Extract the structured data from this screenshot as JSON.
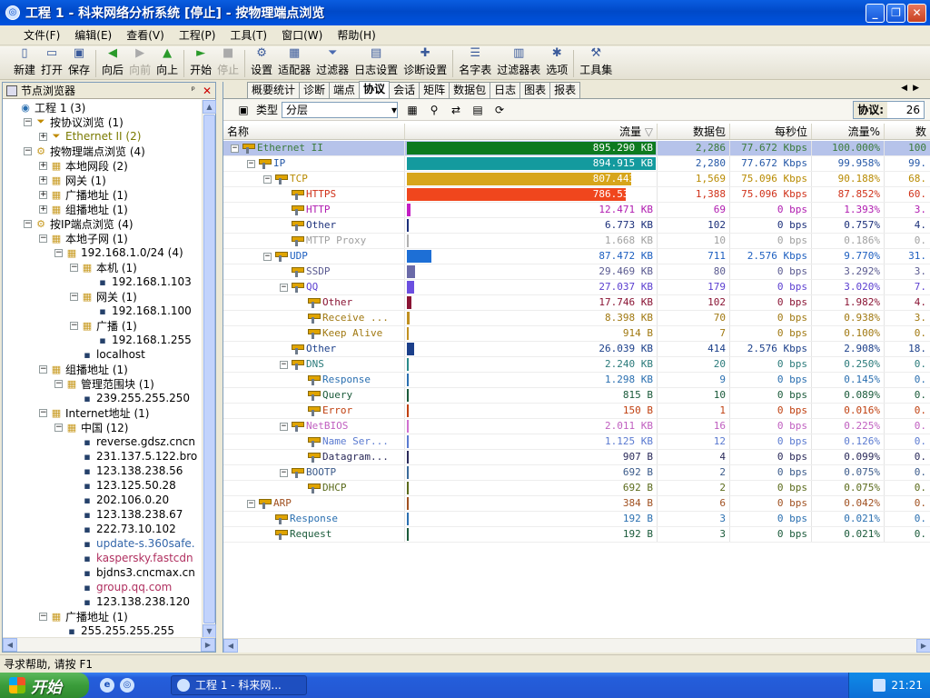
{
  "window": {
    "title": "工程 1 - 科来网络分析系统 [停止] - 按物理端点浏览"
  },
  "menu": [
    "文件(F)",
    "编辑(E)",
    "查看(V)",
    "工程(P)",
    "工具(T)",
    "窗口(W)",
    "帮助(H)"
  ],
  "toolbar": [
    {
      "label": "新建",
      "icon": "new-file-icon",
      "enabled": true
    },
    {
      "label": "打开",
      "icon": "open-folder-icon",
      "enabled": true
    },
    {
      "label": "保存",
      "icon": "save-icon",
      "enabled": true
    },
    {
      "label": "向后",
      "icon": "back-arrow-icon",
      "enabled": true
    },
    {
      "label": "向前",
      "icon": "forward-arrow-icon",
      "enabled": false
    },
    {
      "label": "向上",
      "icon": "up-arrow-icon",
      "enabled": true
    },
    {
      "label": "开始",
      "icon": "start-icon",
      "enabled": true
    },
    {
      "label": "停止",
      "icon": "stop-icon",
      "enabled": false
    },
    {
      "label": "设置",
      "icon": "settings-icon",
      "enabled": true
    },
    {
      "label": "适配器",
      "icon": "adapter-icon",
      "enabled": true
    },
    {
      "label": "过滤器",
      "icon": "filter-icon",
      "enabled": true
    },
    {
      "label": "日志设置",
      "icon": "log-settings-icon",
      "enabled": true
    },
    {
      "label": "诊断设置",
      "icon": "diagnosis-settings-icon",
      "enabled": true
    },
    {
      "label": "名字表",
      "icon": "name-table-icon",
      "enabled": true
    },
    {
      "label": "过滤器表",
      "icon": "filter-table-icon",
      "enabled": true
    },
    {
      "label": "选项",
      "icon": "options-icon",
      "enabled": true
    },
    {
      "label": "工具集",
      "icon": "toolset-icon",
      "enabled": true
    }
  ],
  "left_pane": {
    "title": "节点浏览器",
    "pin": "ᵖ",
    "close": "✕",
    "tree": [
      {
        "label": "工程 1 (3)",
        "indent": 0,
        "exp": "",
        "icon": "project-icon",
        "style": ""
      },
      {
        "label": "按协议浏览 (1)",
        "indent": 1,
        "exp": "−",
        "icon": "protocol-icon",
        "style": ""
      },
      {
        "label": "Ethernet II (2)",
        "indent": 2,
        "exp": "+",
        "icon": "protocol-icon",
        "style": "olive"
      },
      {
        "label": "按物理端点浏览 (4)",
        "indent": 1,
        "exp": "−",
        "icon": "physical-endpoint-icon",
        "style": ""
      },
      {
        "label": "本地网段 (2)",
        "indent": 2,
        "exp": "+",
        "icon": "local-segment-icon",
        "style": ""
      },
      {
        "label": "网关 (1)",
        "indent": 2,
        "exp": "+",
        "icon": "gateway-icon",
        "style": ""
      },
      {
        "label": "广播地址 (1)",
        "indent": 2,
        "exp": "+",
        "icon": "broadcast-icon",
        "style": ""
      },
      {
        "label": "组播地址 (1)",
        "indent": 2,
        "exp": "+",
        "icon": "multicast-icon",
        "style": ""
      },
      {
        "label": "按IP端点浏览 (4)",
        "indent": 1,
        "exp": "−",
        "icon": "ip-endpoint-icon",
        "style": ""
      },
      {
        "label": "本地子网 (1)",
        "indent": 2,
        "exp": "−",
        "icon": "local-subnet-icon",
        "style": ""
      },
      {
        "label": "192.168.1.0/24 (4)",
        "indent": 3,
        "exp": "−",
        "icon": "subnet-icon",
        "style": ""
      },
      {
        "label": "本机 (1)",
        "indent": 4,
        "exp": "−",
        "icon": "host-icon",
        "style": ""
      },
      {
        "label": "192.168.1.103",
        "indent": 5,
        "exp": "",
        "icon": "computer-icon",
        "style": ""
      },
      {
        "label": "网关 (1)",
        "indent": 4,
        "exp": "−",
        "icon": "gateway-icon",
        "style": ""
      },
      {
        "label": "192.168.1.100",
        "indent": 5,
        "exp": "",
        "icon": "computer-icon",
        "style": ""
      },
      {
        "label": "广播 (1)",
        "indent": 4,
        "exp": "−",
        "icon": "broadcast-icon",
        "style": ""
      },
      {
        "label": "192.168.1.255",
        "indent": 5,
        "exp": "",
        "icon": "computer-icon",
        "style": ""
      },
      {
        "label": "localhost",
        "indent": 4,
        "exp": "",
        "icon": "computer-icon",
        "style": ""
      },
      {
        "label": "组播地址 (1)",
        "indent": 2,
        "exp": "−",
        "icon": "multicast-icon",
        "style": ""
      },
      {
        "label": "管理范围块 (1)",
        "indent": 3,
        "exp": "−",
        "icon": "scope-icon",
        "style": ""
      },
      {
        "label": "239.255.255.250",
        "indent": 4,
        "exp": "",
        "icon": "computer-icon",
        "style": ""
      },
      {
        "label": "Internet地址 (1)",
        "indent": 2,
        "exp": "−",
        "icon": "internet-icon",
        "style": ""
      },
      {
        "label": "中国 (12)",
        "indent": 3,
        "exp": "−",
        "icon": "country-icon",
        "style": ""
      },
      {
        "label": "reverse.gdsz.cncn",
        "indent": 4,
        "exp": "",
        "icon": "computer-icon",
        "style": ""
      },
      {
        "label": "231.137.5.122.bro",
        "indent": 4,
        "exp": "",
        "icon": "computer-icon",
        "style": ""
      },
      {
        "label": "123.138.238.56",
        "indent": 4,
        "exp": "",
        "icon": "computer-icon",
        "style": ""
      },
      {
        "label": "123.125.50.28",
        "indent": 4,
        "exp": "",
        "icon": "computer-icon",
        "style": ""
      },
      {
        "label": "202.106.0.20",
        "indent": 4,
        "exp": "",
        "icon": "computer-icon",
        "style": ""
      },
      {
        "label": "123.138.238.67",
        "indent": 4,
        "exp": "",
        "icon": "computer-icon",
        "style": ""
      },
      {
        "label": "222.73.10.102",
        "indent": 4,
        "exp": "",
        "icon": "computer-icon",
        "style": ""
      },
      {
        "label": "update-s.360safe.",
        "indent": 4,
        "exp": "",
        "icon": "computer-icon",
        "style": "blue"
      },
      {
        "label": "kaspersky.fastcdn",
        "indent": 4,
        "exp": "",
        "icon": "computer-icon",
        "style": "red"
      },
      {
        "label": "bjdns3.cncmax.cn",
        "indent": 4,
        "exp": "",
        "icon": "computer-icon",
        "style": ""
      },
      {
        "label": "group.qq.com",
        "indent": 4,
        "exp": "",
        "icon": "computer-icon",
        "style": "red"
      },
      {
        "label": "123.138.238.120",
        "indent": 4,
        "exp": "",
        "icon": "computer-icon",
        "style": ""
      },
      {
        "label": "广播地址 (1)",
        "indent": 2,
        "exp": "−",
        "icon": "broadcast-icon",
        "style": ""
      },
      {
        "label": "255.255.255.255",
        "indent": 3,
        "exp": "",
        "icon": "computer-icon",
        "style": ""
      }
    ]
  },
  "tabs": [
    "概要统计",
    "诊断",
    "端点",
    "协议",
    "会话",
    "矩阵",
    "数据包",
    "日志",
    "图表",
    "报表"
  ],
  "active_tab": "协议",
  "subbar": {
    "type_label": "类型",
    "type_value": "分层",
    "proto_label": "协议:",
    "proto_count": "26"
  },
  "columns": [
    "名称",
    "流量",
    "数据包",
    "每秒位",
    "流量%",
    "数"
  ],
  "rows": [
    {
      "name": "Ethernet II",
      "level": 0,
      "exp": "−",
      "traffic": "895.290 KB",
      "packets": "2,286",
      "bps": "77.672 Kbps",
      "pct": "100.000%",
      "extra": "100",
      "color": "#0d7a1f",
      "fill": 1.0,
      "sel": true,
      "text": "#3b7a3b"
    },
    {
      "name": "IP",
      "level": 1,
      "exp": "−",
      "traffic": "894.915 KB",
      "packets": "2,280",
      "bps": "77.672 Kbps",
      "pct": "99.958%",
      "extra": "99.",
      "color": "#149a9e",
      "fill": 0.9996,
      "text": "#2457a6"
    },
    {
      "name": "TCP",
      "level": 2,
      "exp": "−",
      "traffic": "807.443 KB",
      "packets": "1,569",
      "bps": "75.096 Kbps",
      "pct": "90.188%",
      "extra": "68.",
      "color": "#d7a51a",
      "fill": 0.9019,
      "text": "#b88a00"
    },
    {
      "name": "HTTPS",
      "level": 3,
      "exp": "",
      "traffic": "786.531 KB",
      "packets": "1,388",
      "bps": "75.096 Kbps",
      "pct": "87.852%",
      "extra": "60.",
      "color": "#f0461d",
      "fill": 0.8785,
      "text": "#d0321a"
    },
    {
      "name": "HTTP",
      "level": 3,
      "exp": "",
      "traffic": "12.471 KB",
      "packets": "69",
      "bps": "0 bps",
      "pct": "1.393%",
      "extra": "3.",
      "color": "#c41ec4",
      "fill": 0.0139,
      "text": "#b01cb0"
    },
    {
      "name": "Other",
      "level": 3,
      "exp": "",
      "traffic": "6.773 KB",
      "packets": "102",
      "bps": "0 bps",
      "pct": "0.757%",
      "extra": "4.",
      "color": "#1b2f7a",
      "fill": 0.0076,
      "text": "#1b2f7a"
    },
    {
      "name": "MTTP Proxy",
      "level": 3,
      "exp": "",
      "traffic": "1.668 KB",
      "packets": "10",
      "bps": "0 bps",
      "pct": "0.186%",
      "extra": "0.",
      "color": "#b0b0b0",
      "fill": 0.0019,
      "text": "#a0a0a0"
    },
    {
      "name": "UDP",
      "level": 2,
      "exp": "−",
      "traffic": "87.472 KB",
      "packets": "711",
      "bps": "2.576 Kbps",
      "pct": "9.770%",
      "extra": "31.",
      "color": "#1d6fd6",
      "fill": 0.0977,
      "text": "#1d5fc0"
    },
    {
      "name": "SSDP",
      "level": 3,
      "exp": "",
      "traffic": "29.469 KB",
      "packets": "80",
      "bps": "0 bps",
      "pct": "3.292%",
      "extra": "3.",
      "color": "#6a6aa8",
      "fill": 0.0329,
      "text": "#5a5a90"
    },
    {
      "name": "QQ",
      "level": 3,
      "exp": "−",
      "traffic": "27.037 KB",
      "packets": "179",
      "bps": "0 bps",
      "pct": "3.020%",
      "extra": "7.",
      "color": "#6b4fe0",
      "fill": 0.0302,
      "text": "#5b3fd0"
    },
    {
      "name": "Other",
      "level": 4,
      "exp": "",
      "traffic": "17.746 KB",
      "packets": "102",
      "bps": "0 bps",
      "pct": "1.982%",
      "extra": "4.",
      "color": "#8a1434",
      "fill": 0.0198,
      "text": "#8a1434"
    },
    {
      "name": "Receive ...",
      "level": 4,
      "exp": "",
      "traffic": "8.398 KB",
      "packets": "70",
      "bps": "0 bps",
      "pct": "0.938%",
      "extra": "3.",
      "color": "#c09020",
      "fill": 0.0094,
      "text": "#a07810"
    },
    {
      "name": "Keep Alive",
      "level": 4,
      "exp": "",
      "traffic": "914 B",
      "packets": "7",
      "bps": "0 bps",
      "pct": "0.100%",
      "extra": "0.",
      "color": "#c09020",
      "fill": 0.001,
      "text": "#a07810"
    },
    {
      "name": "Other",
      "level": 3,
      "exp": "",
      "traffic": "26.039 KB",
      "packets": "414",
      "bps": "2.576 Kbps",
      "pct": "2.908%",
      "extra": "18.",
      "color": "#1b3f8a",
      "fill": 0.0291,
      "text": "#1b3f8a"
    },
    {
      "name": "DNS",
      "level": 3,
      "exp": "−",
      "traffic": "2.240 KB",
      "packets": "20",
      "bps": "0 bps",
      "pct": "0.250%",
      "extra": "0.",
      "color": "#2a8a8a",
      "fill": 0.0025,
      "text": "#2a7a7a"
    },
    {
      "name": "Response",
      "level": 4,
      "exp": "",
      "traffic": "1.298 KB",
      "packets": "9",
      "bps": "0 bps",
      "pct": "0.145%",
      "extra": "0.",
      "color": "#2a6fb0",
      "fill": 0.0015,
      "text": "#2a6fb0"
    },
    {
      "name": "Query",
      "level": 4,
      "exp": "",
      "traffic": "815 B",
      "packets": "10",
      "bps": "0 bps",
      "pct": "0.089%",
      "extra": "0.",
      "color": "#1a5a3a",
      "fill": 0.0009,
      "text": "#1a5a3a"
    },
    {
      "name": "Error",
      "level": 4,
      "exp": "",
      "traffic": "150 B",
      "packets": "1",
      "bps": "0 bps",
      "pct": "0.016%",
      "extra": "0.",
      "color": "#c04010",
      "fill": 0.0002,
      "text": "#c04010"
    },
    {
      "name": "NetBIOS",
      "level": 3,
      "exp": "−",
      "traffic": "2.011 KB",
      "packets": "16",
      "bps": "0 bps",
      "pct": "0.225%",
      "extra": "0.",
      "color": "#d070d0",
      "fill": 0.0022,
      "text": "#c060c0"
    },
    {
      "name": "Name Ser...",
      "level": 4,
      "exp": "",
      "traffic": "1.125 KB",
      "packets": "12",
      "bps": "0 bps",
      "pct": "0.126%",
      "extra": "0.",
      "color": "#5a7ad0",
      "fill": 0.0013,
      "text": "#5a7ad0"
    },
    {
      "name": "Datagram...",
      "level": 4,
      "exp": "",
      "traffic": "907 B",
      "packets": "4",
      "bps": "0 bps",
      "pct": "0.099%",
      "extra": "0.",
      "color": "#2a2a5a",
      "fill": 0.001,
      "text": "#2a2a5a"
    },
    {
      "name": "BOOTP",
      "level": 3,
      "exp": "−",
      "traffic": "692 B",
      "packets": "2",
      "bps": "0 bps",
      "pct": "0.075%",
      "extra": "0.",
      "color": "#3a6a9a",
      "fill": 0.0008,
      "text": "#3a5a8a"
    },
    {
      "name": "DHCP",
      "level": 4,
      "exp": "",
      "traffic": "692 B",
      "packets": "2",
      "bps": "0 bps",
      "pct": "0.075%",
      "extra": "0.",
      "color": "#5a6a1a",
      "fill": 0.0008,
      "text": "#5a6a1a"
    },
    {
      "name": "ARP",
      "level": 1,
      "exp": "−",
      "traffic": "384 B",
      "packets": "6",
      "bps": "0 bps",
      "pct": "0.042%",
      "extra": "0.",
      "color": "#a05020",
      "fill": 0.0004,
      "text": "#a05020"
    },
    {
      "name": "Response",
      "level": 2,
      "exp": "",
      "traffic": "192 B",
      "packets": "3",
      "bps": "0 bps",
      "pct": "0.021%",
      "extra": "0.",
      "color": "#2a6fb0",
      "fill": 0.0002,
      "text": "#2a6fb0"
    },
    {
      "name": "Request",
      "level": 2,
      "exp": "",
      "traffic": "192 B",
      "packets": "3",
      "bps": "0 bps",
      "pct": "0.021%",
      "extra": "0.",
      "color": "#1a5a3a",
      "fill": 0.0002,
      "text": "#1a5a3a"
    }
  ],
  "status": "寻求帮助, 请按 F1",
  "taskbar": {
    "start": "开始",
    "task": "工程 1 - 科来网...",
    "time": "21:21"
  }
}
